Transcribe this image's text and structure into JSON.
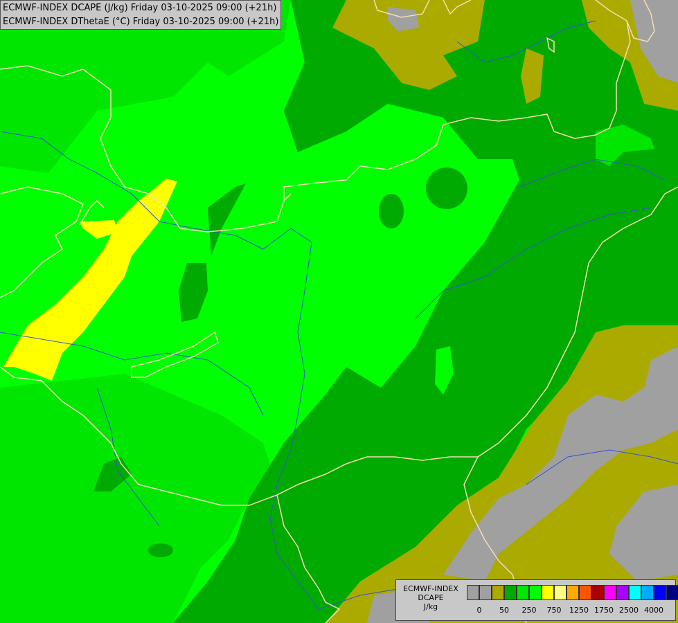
{
  "title": {
    "line1": "ECMWF-INDEX DCAPE (J/kg) Friday 03-10-2025 09:00 (+21h)",
    "line2": "ECMWF-INDEX DThetaE (°C) Friday 03-10-2025 09:00 (+21h)"
  },
  "legend": {
    "line1": "ECMWF-INDEX",
    "line2": "DCAPE",
    "line3": "J/kg",
    "colors": [
      "#a0a0a0",
      "#a0a0a0",
      "#aaaa00",
      "#00aa00",
      "#00e600",
      "#00ff00",
      "#ffff00",
      "#ffff80",
      "#ffaa00",
      "#ff5500",
      "#aa0000",
      "#ff00ff",
      "#aa00ff",
      "#00ffff",
      "#00aaff",
      "#0000ff",
      "#000080"
    ],
    "ticks": [
      "0",
      "50",
      "250",
      "750",
      "1250",
      "1750",
      "2500",
      "4000"
    ]
  },
  "colors": {
    "bright_green": "#00ff00",
    "mid_green": "#00e600",
    "dark_green": "#00aa00",
    "olive": "#aaaa00",
    "gray": "#a0a0a0",
    "yellow": "#ffff00",
    "borders": "#f5deb3",
    "rivers": "#3355cc"
  }
}
